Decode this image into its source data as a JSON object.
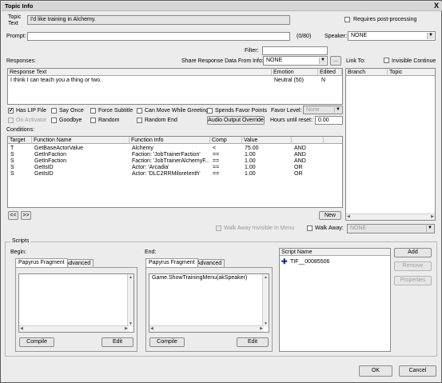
{
  "window": {
    "title": "Topic Info",
    "close": "X"
  },
  "topic": {
    "label_line1": "Topic",
    "label_line2": "Text",
    "value": "I'd like training in Alchemy.",
    "requires_post_processing_label": "Requires post-processing",
    "requires_post_processing": false
  },
  "prompt": {
    "label": "Prompt:",
    "value": "",
    "count": "(0/80)"
  },
  "speaker": {
    "label": "Speaker:",
    "value": "NONE"
  },
  "filter": {
    "label": "Filter:",
    "value": ""
  },
  "responses": {
    "label": "Responses:",
    "share_label": "Share Response Data From Info:",
    "share_value": "NONE",
    "ellipsis": "...",
    "columns": [
      "Response Text",
      "Emotion",
      "Edited"
    ],
    "rows": [
      {
        "text": "I think I can teach you a thing or two.",
        "emotion": "Neutral (50)",
        "edited": "N"
      }
    ]
  },
  "link_to": {
    "label": "Link To:",
    "invisible_continue_label": "Invisible Continue",
    "invisible_continue": false,
    "columns": [
      "Branch",
      "Topic"
    ]
  },
  "options": {
    "has_lip_file": "Has LIP File",
    "say_once": "Say Once",
    "force_subtitle": "Force Subtitle",
    "can_move_while_greeting": "Can Move While Greeting",
    "spends_favor_points": "Spends Favor Points",
    "favor_level_label": "Favor Level:",
    "favor_level_value": "None",
    "on_activation": "On Activator",
    "goodbye": "Goodbye",
    "random": "Random",
    "random_end": "Random End",
    "audio_output_override": "Audio Output Override",
    "hours_until_reset_label": "Hours until reset:",
    "hours_until_reset_value": "0.00"
  },
  "conditions": {
    "label": "Conditions:",
    "columns": [
      "Target",
      "Function Name",
      "Function Info",
      "Comp",
      "Value",
      ""
    ],
    "rows": [
      {
        "target": "T",
        "function": "GetBaseActorValue",
        "info": "Alchemy",
        "comp": "<",
        "value": "75.00",
        "logic": "AND"
      },
      {
        "target": "S",
        "function": "GetInFaction",
        "info": "Faction: 'JobTrainerFaction'",
        "comp": "==",
        "value": "1.00",
        "logic": "AND"
      },
      {
        "target": "S",
        "function": "GetInFaction",
        "info": "Faction: 'JobTrainerAlchemyF...",
        "comp": "==",
        "value": "1.00",
        "logic": "AND"
      },
      {
        "target": "S",
        "function": "GetIsID",
        "info": "Actor: 'Arcadia'",
        "comp": "==",
        "value": "1.00",
        "logic": "OR"
      },
      {
        "target": "S",
        "function": "GetIsID",
        "info": "Actor: 'DLC2RRMiloreIenth'",
        "comp": "==",
        "value": "1.00",
        "logic": "OR"
      }
    ],
    "prev": "<<",
    "next": ">>",
    "new": "New"
  },
  "walk_away": {
    "invisible_label": "Walk Away Invisible In Menu",
    "label": "Walk Away:",
    "value": "NONE"
  },
  "scripts": {
    "label": "Scripts",
    "begin": {
      "label": "Begin:",
      "tabs": [
        "Papyrus Fragment",
        "Advanced"
      ],
      "text": "",
      "compile": "Compile",
      "edit": "Edit"
    },
    "end": {
      "label": "End:",
      "tabs": [
        "Papyrus Fragment",
        "Advanced"
      ],
      "text": "Game.ShowTrainingMenu(akSpeaker)",
      "compile": "Compile",
      "edit": "Edit"
    },
    "list": {
      "column": "Script Name",
      "items": [
        "TIF__00085506"
      ]
    },
    "add": "Add",
    "remove": "Remove",
    "properties": "Properties"
  },
  "footer": {
    "ok": "OK",
    "cancel": "Cancel"
  }
}
